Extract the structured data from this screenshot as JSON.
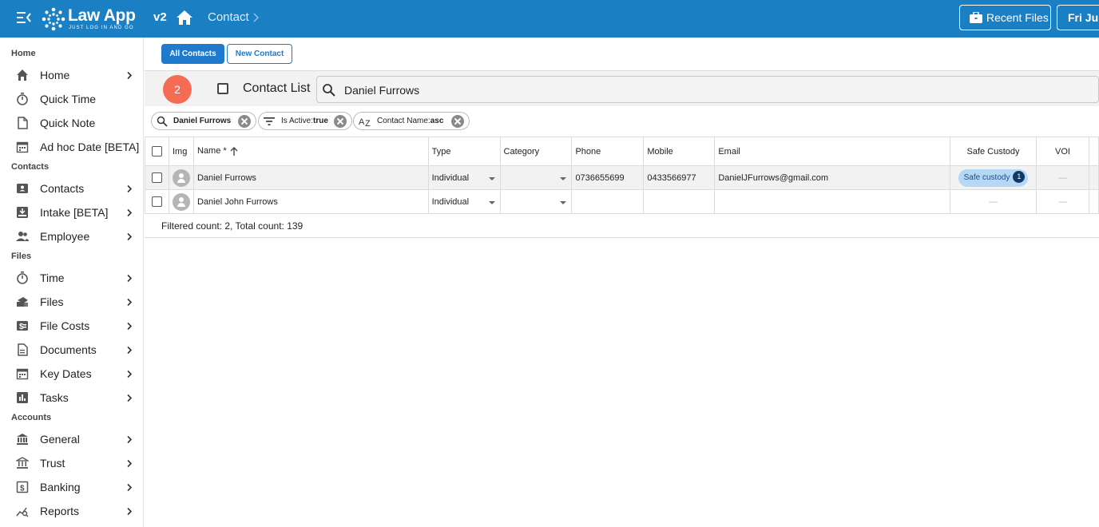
{
  "app": {
    "brand": "Law App",
    "tagline": "JUST LOG IN AND GO",
    "version": "v2",
    "breadcrumb": "Contact",
    "recent_files_label": "Recent Files",
    "date_label": "Fri Jul"
  },
  "sidebar": {
    "sections": [
      {
        "title": "Home",
        "items": [
          {
            "label": "Home",
            "icon": "home-icon",
            "chevron": true
          },
          {
            "label": "Quick Time",
            "icon": "stopwatch-icon",
            "chevron": false
          },
          {
            "label": "Quick Note",
            "icon": "note-icon",
            "chevron": false
          },
          {
            "label": "Ad hoc Date [BETA]",
            "icon": "calendar-icon",
            "chevron": false
          }
        ]
      },
      {
        "title": "Contacts",
        "items": [
          {
            "label": "Contacts",
            "icon": "contacts-icon",
            "chevron": true
          },
          {
            "label": "Intake [BETA]",
            "icon": "inbox-icon",
            "chevron": true
          },
          {
            "label": "Employee",
            "icon": "people-icon",
            "chevron": true
          }
        ]
      },
      {
        "title": "Files",
        "items": [
          {
            "label": "Time",
            "icon": "stopwatch-icon",
            "chevron": true
          },
          {
            "label": "Files",
            "icon": "files-icon",
            "chevron": true
          },
          {
            "label": "File Costs",
            "icon": "dollar-card-icon",
            "chevron": true
          },
          {
            "label": "Documents",
            "icon": "document-icon",
            "chevron": true
          },
          {
            "label": "Key Dates",
            "icon": "calendar-icon",
            "chevron": true
          },
          {
            "label": "Tasks",
            "icon": "tasks-chart-icon",
            "chevron": true
          }
        ]
      },
      {
        "title": "Accounts",
        "items": [
          {
            "label": "General",
            "icon": "bank-icon",
            "chevron": true
          },
          {
            "label": "Trust",
            "icon": "trust-bank-icon",
            "chevron": true
          },
          {
            "label": "Banking",
            "icon": "dollar-box-icon",
            "chevron": true
          },
          {
            "label": "Reports",
            "icon": "report-search-icon",
            "chevron": true
          }
        ]
      }
    ]
  },
  "tabs": {
    "all_contacts": "All Contacts",
    "new_contact": "New Contact"
  },
  "list": {
    "count": "2",
    "title": "Contact List",
    "search_value": "Daniel Furrows"
  },
  "filters": [
    {
      "prefix": "",
      "value": "Daniel Furrows",
      "icon": "search-icon"
    },
    {
      "prefix": "Is Active:",
      "value": "true",
      "icon": "filter-icon"
    },
    {
      "prefix": "Contact Name:",
      "value": "asc",
      "icon": "sort-az-icon"
    }
  ],
  "table": {
    "columns": {
      "img": "Img",
      "name": "Name *",
      "type": "Type",
      "category": "Category",
      "phone": "Phone",
      "mobile": "Mobile",
      "email": "Email",
      "safe_custody": "Safe Custody",
      "voi": "VOI"
    },
    "rows": [
      {
        "name": "Daniel Furrows",
        "type": "Individual",
        "category": "",
        "phone": "0736655699",
        "mobile": "0433566977",
        "email": "DanielJFurrows@gmail.com",
        "safe_custody_label": "Safe custody",
        "safe_custody_count": "1",
        "voi": "—"
      },
      {
        "name": "Daniel John Furrows",
        "type": "Individual",
        "category": "",
        "phone": "",
        "mobile": "",
        "email": "",
        "safe_custody_label": "—",
        "safe_custody_count": "",
        "voi": "—"
      }
    ]
  },
  "footer": {
    "counts": "Filtered count: 2, Total count: 139"
  },
  "colors": {
    "topbar": "#1b7fc4",
    "primary": "#1f79cc",
    "badge": "#f56c55",
    "safe_chip": "#b7d8f4"
  }
}
